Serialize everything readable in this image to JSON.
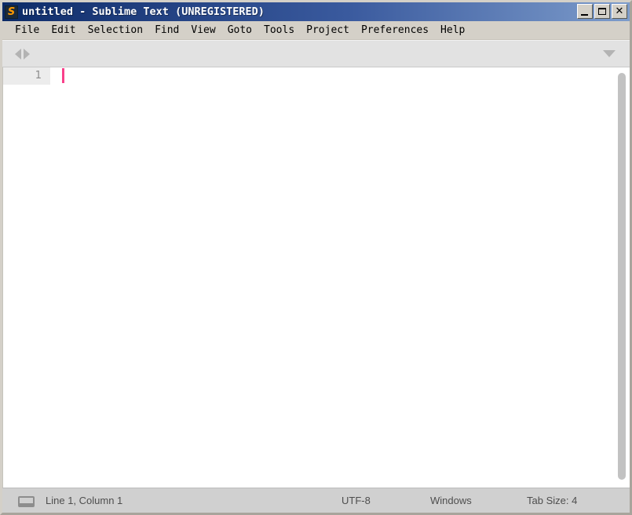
{
  "window": {
    "title": "untitled - Sublime Text (UNREGISTERED)",
    "app_icon": "sublime-text-icon",
    "icon_glyph": "S",
    "controls": {
      "minimize_label": "_",
      "maximize_label": "□",
      "close_label": "✕"
    },
    "accent_colors": {
      "titlebar_left": "#0b2a66",
      "titlebar_right": "#7d9ccb",
      "caret": "#f9408a",
      "icon_orange": "#ff9a00",
      "chrome": "#d4d0c8"
    }
  },
  "menubar": {
    "items": [
      {
        "label": "File"
      },
      {
        "label": "Edit"
      },
      {
        "label": "Selection"
      },
      {
        "label": "Find"
      },
      {
        "label": "View"
      },
      {
        "label": "Goto"
      },
      {
        "label": "Tools"
      },
      {
        "label": "Project"
      },
      {
        "label": "Preferences"
      },
      {
        "label": "Help"
      }
    ]
  },
  "tabbar": {
    "scroll_left_icon": "triangle-left-icon",
    "scroll_right_icon": "triangle-right-icon",
    "dropdown_icon": "chevron-down-icon",
    "tabs": []
  },
  "editor": {
    "line_numbers": [
      "1"
    ],
    "content": "",
    "caret_line": 1,
    "caret_column": 1
  },
  "statusbar": {
    "console_icon": "console-icon",
    "position": "Line 1, Column 1",
    "encoding": "UTF-8",
    "line_ending": "Windows",
    "tab_size": "Tab Size: 4"
  }
}
